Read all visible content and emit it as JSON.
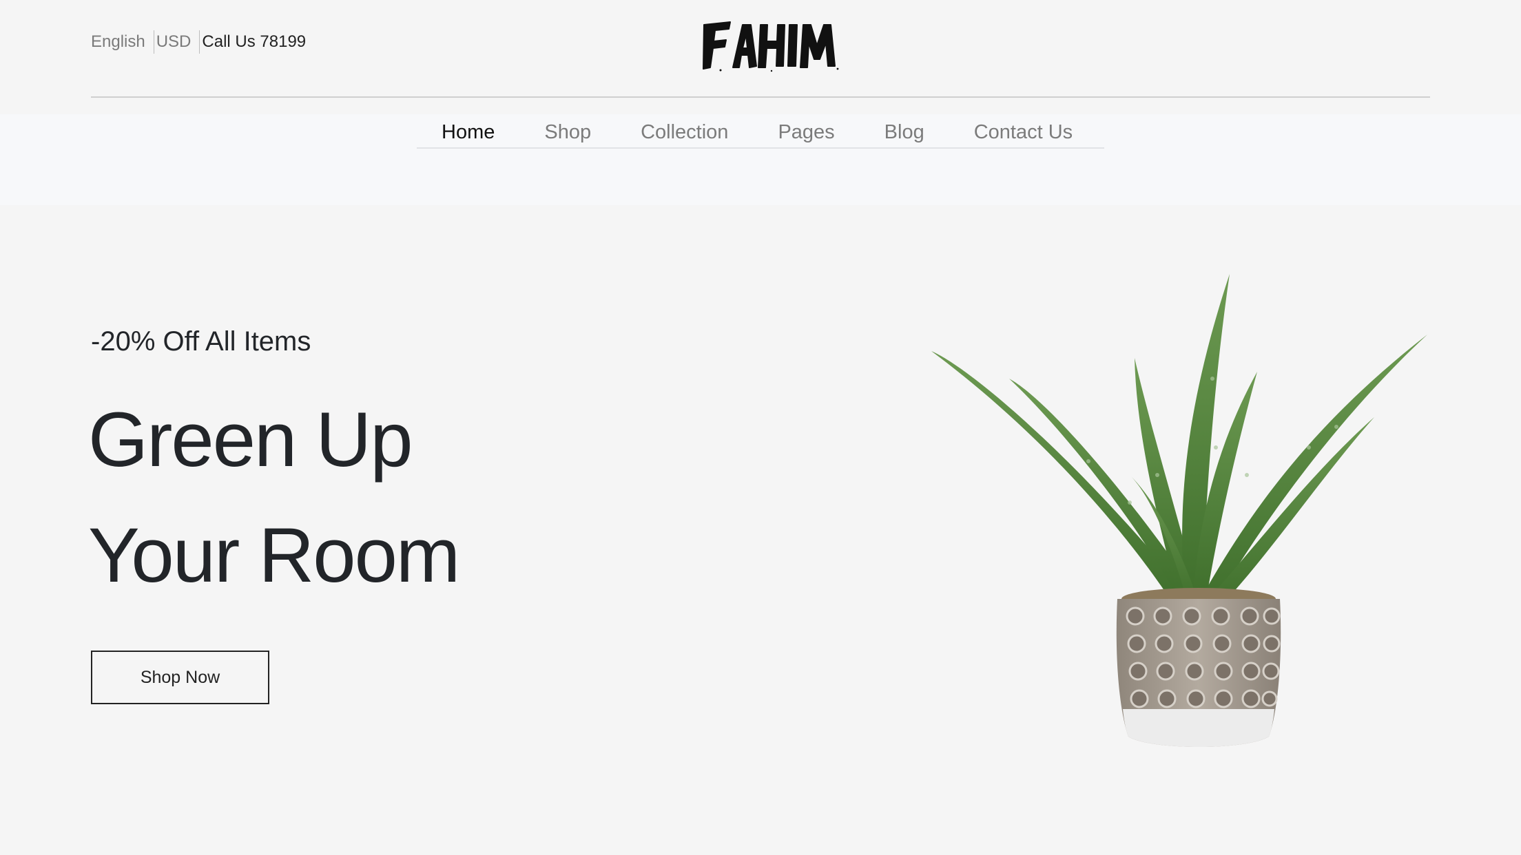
{
  "topbar": {
    "language": "English",
    "currency": "USD",
    "call": "Call Us 78199",
    "logo_text": "FAHIM"
  },
  "nav": {
    "items": [
      {
        "label": "Home",
        "active": true
      },
      {
        "label": "Shop",
        "active": false
      },
      {
        "label": "Collection",
        "active": false
      },
      {
        "label": "Pages",
        "active": false
      },
      {
        "label": "Blog",
        "active": false
      },
      {
        "label": "Contact Us",
        "active": false
      }
    ]
  },
  "hero": {
    "promo": "-20% Off All Items",
    "headline_line1": "Green Up",
    "headline_line2": "Your Room",
    "cta_label": "Shop Now",
    "image": "aloe-plant-in-pot"
  },
  "colors": {
    "background": "#f5f5f5",
    "nav_band": "#f7f8fa",
    "text_dark": "#222529",
    "text_muted": "#7b7b7b",
    "plant_green": "#5e8f46",
    "pot": "#a39a8f"
  }
}
